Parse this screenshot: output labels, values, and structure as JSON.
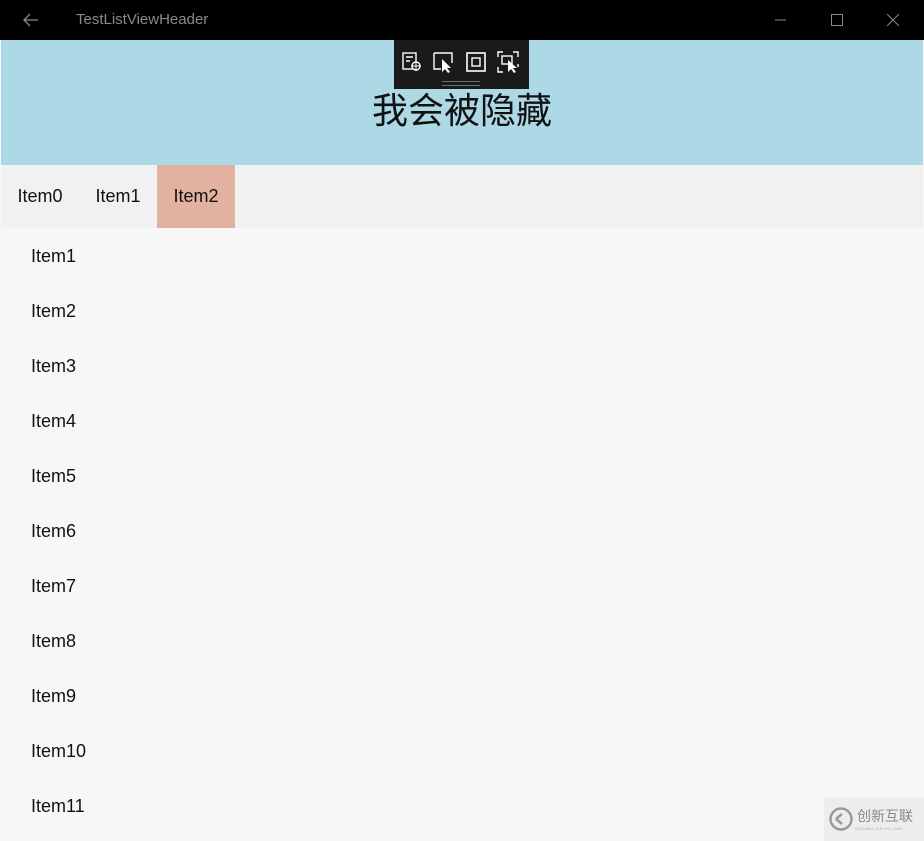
{
  "window": {
    "title": "TestListViewHeader",
    "back_icon": "back-arrow-icon",
    "controls": [
      "minimize-icon",
      "maximize-icon",
      "close-icon"
    ]
  },
  "header": {
    "text": "我会被隐藏",
    "background": "#add8e6"
  },
  "devtools": {
    "icons": [
      "live-visual-tree-icon",
      "select-element-icon",
      "display-layout-adorners-icon",
      "track-focus-icon"
    ]
  },
  "tabs": {
    "items": [
      "Item0",
      "Item1",
      "Item2"
    ],
    "selected_index": 2,
    "selected_color": "#e2b1a0"
  },
  "list": {
    "items": [
      "Item1",
      "Item2",
      "Item3",
      "Item4",
      "Item5",
      "Item6",
      "Item7",
      "Item8",
      "Item9",
      "Item10",
      "Item11"
    ]
  },
  "watermark": {
    "logo_icon": "chuangxin-logo-icon",
    "text": "创新互联",
    "subtext": "CHUANG XIN HU LIAN"
  }
}
